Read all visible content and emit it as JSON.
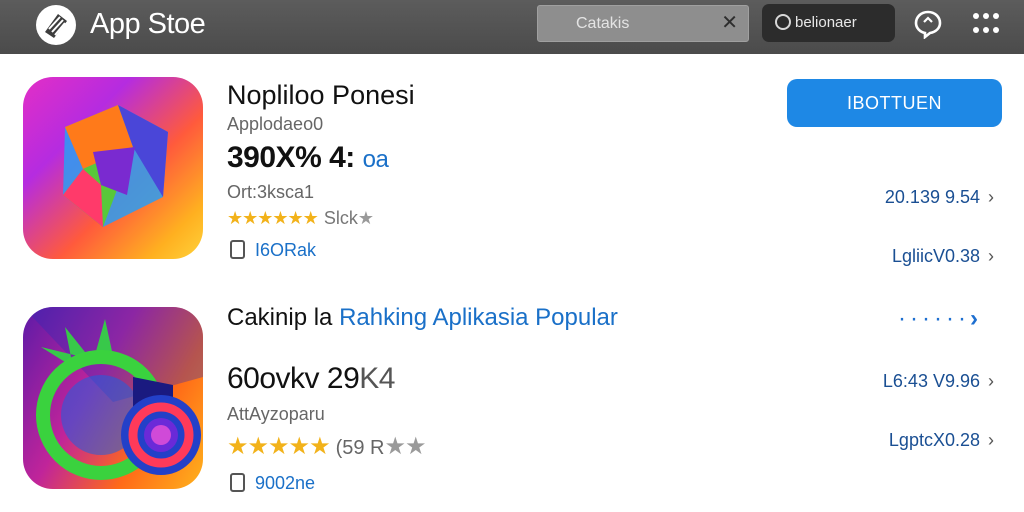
{
  "topbar": {
    "title": "App Stoe",
    "search": {
      "value": "Catakis",
      "clear": "✕"
    },
    "account_label": "belionaer"
  },
  "app1": {
    "name": "Nopliloo Ponesi",
    "developer": "Applodaeo0",
    "size_main": "390X% 4:",
    "size_accent": "oa",
    "category": "Ort:3ksca1",
    "stars": "★★★★★★",
    "rating_text": "Slck",
    "rating_tail": "★",
    "tag": "I6ORak",
    "install_label": "IBOTTUEN",
    "meta1": "20.139 9.54",
    "meta2": "LgliicV0.38"
  },
  "section": {
    "title_plain": "Cakinip la",
    "title_link": "Rahking Aplikasia Popular",
    "see_all_dots": "······",
    "chevron": "›"
  },
  "app2": {
    "name_main": "60ovkv 29",
    "name_dim": "K4",
    "developer": "AttAyzoparu",
    "stars": "★★★★★",
    "rating_text": "(59 R",
    "rating_tail": "★★",
    "tag": "9002ne",
    "meta1": "L6:43 V9.96",
    "meta2": "LgptcX0.28"
  },
  "icons": {
    "logo": "app-store-logo",
    "search": "search-clear-icon",
    "account": "account-icon",
    "chat": "chat-bubble-icon",
    "grid": "grid-menu-icon",
    "chevron": "chevron-right-icon"
  },
  "colors": {
    "topbar": "#505050",
    "accent": "#1e88e5",
    "link": "#1a70c8",
    "star": "#f2b21a"
  }
}
